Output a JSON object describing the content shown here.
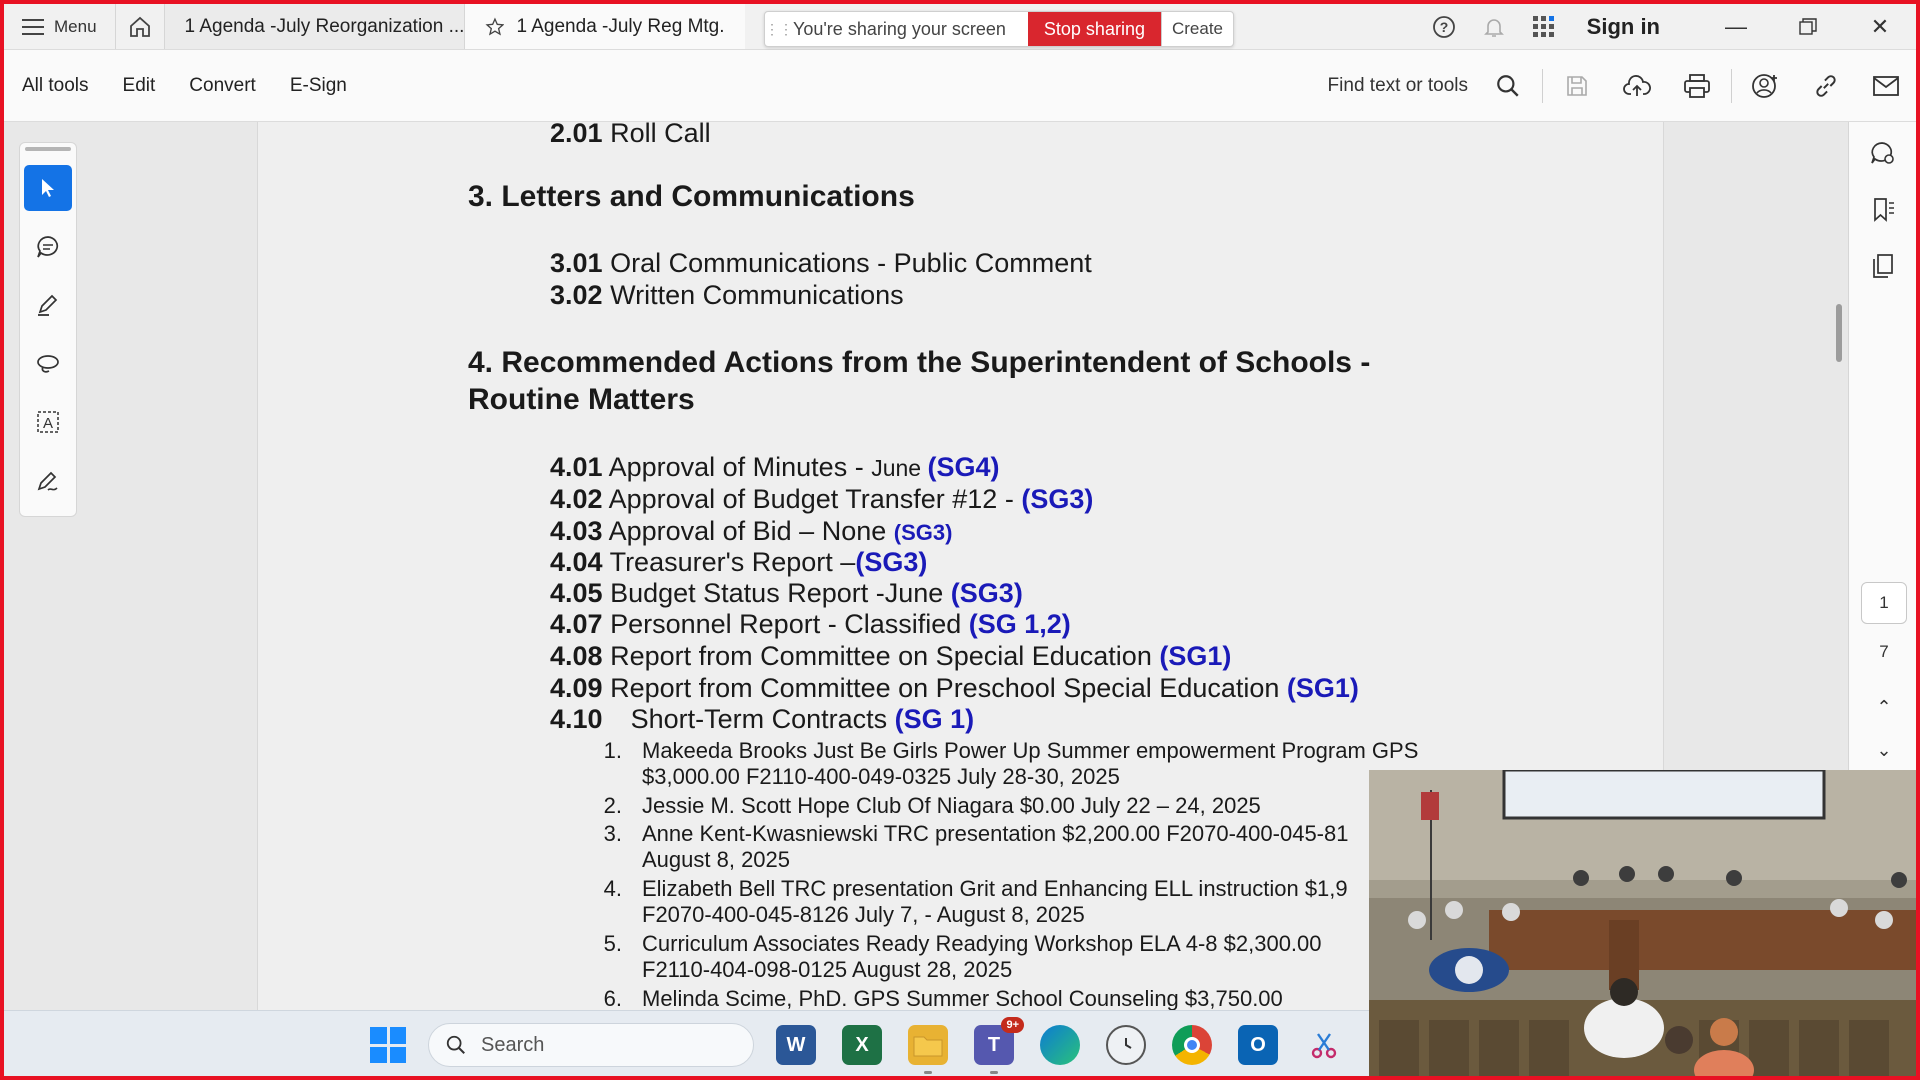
{
  "titlebar": {
    "menu_label": "Menu",
    "tab_inactive": "1 Agenda -July Reorganization ...",
    "tab_active": "1 Agenda -July Reg Mtg.",
    "share_text": "You're sharing your screen",
    "stop_sharing": "Stop sharing",
    "create": "Create",
    "sign_in": "Sign in"
  },
  "toolbar": {
    "items": [
      "All tools",
      "Edit",
      "Convert",
      "E-Sign"
    ],
    "find": "Find text or tools"
  },
  "document": {
    "roll_call": {
      "num": "2.01",
      "text": "Roll Call"
    },
    "sec3": "3. Letters and Communications",
    "items3": [
      {
        "num": "3.01",
        "text": "Oral Communications - Public Comment"
      },
      {
        "num": "3.02",
        "text": "Written Communications"
      }
    ],
    "sec4_line1": "4. Recommended Actions from the Superintendent of Schools -",
    "sec4_line2": "Routine Matters",
    "items4": [
      {
        "num": "4.01",
        "text": "Approval of Minutes - ",
        "small": "June ",
        "sg": "(SG4)"
      },
      {
        "num": "4.02",
        "text": "Approval of Budget Transfer #12 - ",
        "small": "",
        "sg": "(SG3)"
      },
      {
        "num": "4.03",
        "text": "Approval of Bid – None ",
        "small": "",
        "sg": "(SG3)"
      },
      {
        "num": "4.04",
        "text": "Treasurer's Report –",
        "small": "",
        "sg": "(SG3)"
      },
      {
        "num": "4.05",
        "text": "Budget Status Report -June ",
        "small": "",
        "sg": "(SG3)"
      },
      {
        "num": "4.07",
        "text": "Personnel Report - Classified ",
        "small": "",
        "sg": "(SG 1,2)"
      },
      {
        "num": "4.08",
        "text": "Report from Committee on Special Education ",
        "small": "",
        "sg": "(SG1)"
      },
      {
        "num": "4.09",
        "text": "Report from Committee on Preschool Special Education ",
        "small": "",
        "sg": "(SG1)"
      },
      {
        "num": "4.10",
        "text": "Short-Term Contracts ",
        "small": "",
        "sg": "(SG 1)"
      }
    ],
    "contracts": [
      {
        "num": "1.",
        "l1": "Makeeda Brooks Just Be Girls Power Up Summer empowerment Program GPS",
        "l2": "$3,000.00 F2110-400-049-0325 July 28-30, 2025"
      },
      {
        "num": "2.",
        "l1": "Jessie M. Scott Hope Club Of Niagara $0.00 July 22 – 24, 2025",
        "l2": ""
      },
      {
        "num": "3.",
        "l1": "Anne Kent-Kwasniewski TRC presentation  $2,200.00 F2070-400-045-81",
        "l2": "August 8, 2025"
      },
      {
        "num": "4.",
        "l1": "Elizabeth Bell TRC presentation Grit and Enhancing ELL instruction $1,9",
        "l2": "F2070-400-045-8126      July 7, - August 8, 2025"
      },
      {
        "num": "5.",
        "l1": "Curriculum Associates    Ready Readying Workshop ELA 4-8 $2,300.00",
        "l2": "F2110-404-098-0125       August 28, 2025"
      },
      {
        "num": "6.",
        "l1": "Melinda Scime, PhD.    GPS Summer School  Counseling $3,750.00",
        "l2": ""
      }
    ]
  },
  "pager": {
    "current": "1",
    "total": "7"
  },
  "taskbar": {
    "search_placeholder": "Search",
    "teams_badge": "9+"
  },
  "colors": {
    "share_border": "#e81123",
    "sg_blue": "#1a1ab8",
    "stop_red": "#d9262e",
    "selected_tool": "#1473e6"
  }
}
